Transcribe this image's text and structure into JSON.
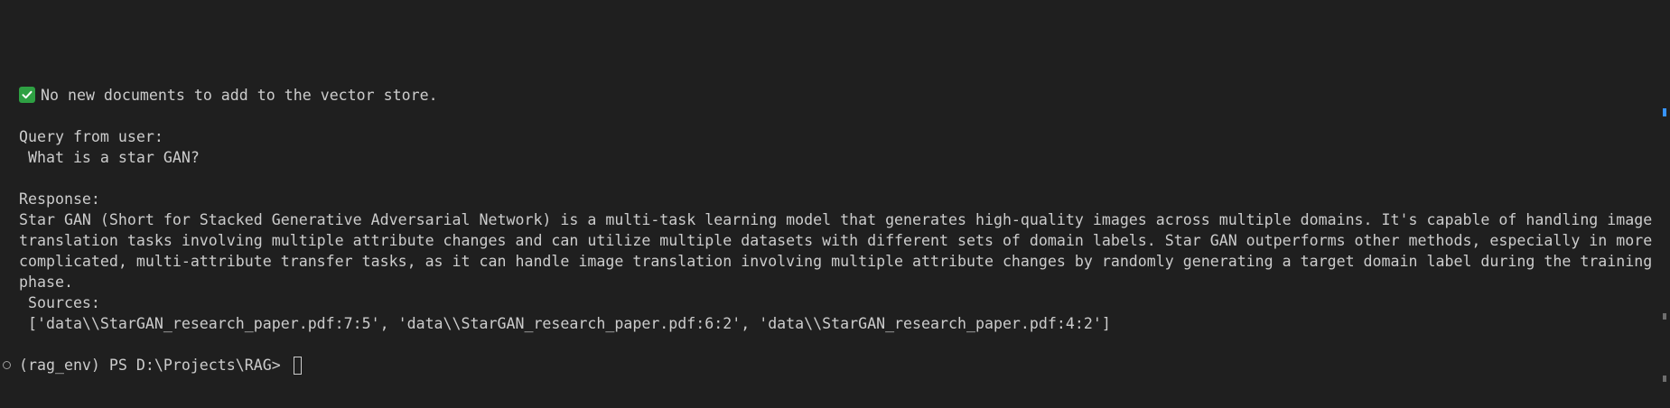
{
  "terminal": {
    "status_line": "No new documents to add to the vector store.",
    "query_label": "Query from user:",
    "query_text": " What is a star GAN?",
    "response_label": "Response:",
    "response_text": " Star GAN (Short for Stacked Generative Adversarial Network) is a multi-task learning model that generates high-quality images across multiple domains. It's capable of handling image translation tasks involving multiple attribute changes and can utilize multiple datasets with different sets of domain labels. Star GAN outperforms other methods, especially in more complicated, multi-attribute transfer tasks, as it can handle image translation involving multiple attribute changes by randomly generating a target domain label during the training phase.",
    "sources_label": " Sources:",
    "sources_text": " ['data\\\\StarGAN_research_paper.pdf:7:5', 'data\\\\StarGAN_research_paper.pdf:6:2', 'data\\\\StarGAN_research_paper.pdf:4:2']",
    "prompt": "(rag_env) PS D:\\Projects\\RAG> "
  },
  "colors": {
    "background": "#1f1f1f",
    "text": "#cccccc",
    "check_green": "#2ea043",
    "scroll_accent": "#3794ff"
  },
  "icons": {
    "status": "check-icon",
    "prompt_marker": "circle-icon"
  }
}
